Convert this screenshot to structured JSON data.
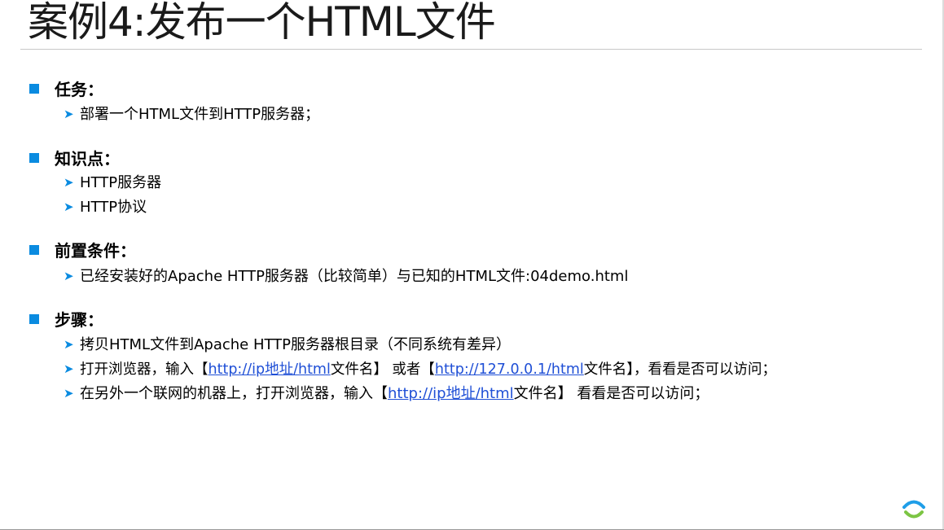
{
  "title": "案例4:发布一个HTML文件",
  "sections": [
    {
      "heading": "任务：",
      "items": [
        {
          "text": "部署一个HTML文件到HTTP服务器；"
        }
      ]
    },
    {
      "heading": "知识点：",
      "items": [
        {
          "text": "HTTP服务器"
        },
        {
          "text": "HTTP协议"
        }
      ]
    },
    {
      "heading": "前置条件：",
      "items": [
        {
          "text": "已经安装好的Apache HTTP服务器（比较简单）与已知的HTML文件:04demo.html"
        }
      ]
    },
    {
      "heading": "步骤：",
      "items": [
        {
          "text": "拷贝HTML文件到Apache HTTP服务器根目录（不同系统有差异）"
        },
        {
          "p1": "打开浏览器，输入【",
          "link1": "http://ip地址/html",
          "p2": "文件名】 或者【",
          "link2": "http://127.0.0.1/html",
          "p3": "文件名】，看看是否可以访问；"
        },
        {
          "p1": "在另外一个联网的机器上，打开浏览器，输入【",
          "link1": "http://ip地址/html",
          "p2": "文件名】 看看是否可以访问；"
        }
      ]
    }
  ],
  "colors": {
    "bullet": "#0a8be0",
    "link": "#1f4fd6",
    "logo_top": "#1f9ee8",
    "logo_bottom": "#7cc544"
  },
  "icons": {
    "section_bullet": "square-bullet-icon",
    "item_bullet": "arrow-bullet-icon",
    "logo": "logo-icon"
  }
}
